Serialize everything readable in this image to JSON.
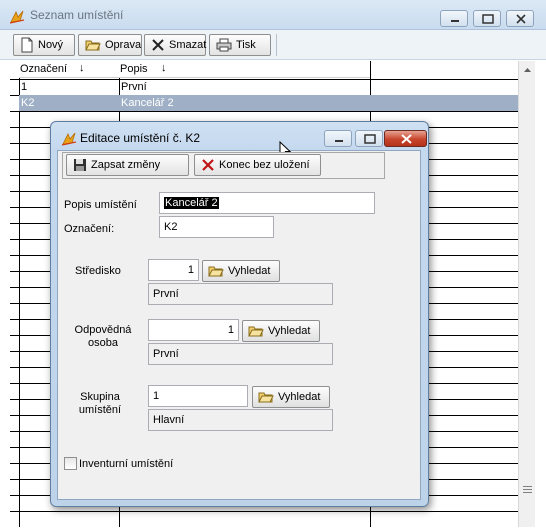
{
  "main_window": {
    "title": "Seznam umístění",
    "toolbar": {
      "new_label": "Nový",
      "edit_label": "Oprava",
      "delete_label": "Smazat",
      "print_label": "Tisk"
    },
    "grid": {
      "columns": [
        "Označení",
        "Popis"
      ],
      "sort_indicator": "↓",
      "rows": [
        {
          "code": "1",
          "description": "První",
          "selected": false
        },
        {
          "code": "K2",
          "description": "Kancelář 2",
          "selected": true
        }
      ]
    }
  },
  "dialog": {
    "title": "Editace umístění č. K2",
    "save_label": "Zapsat změny",
    "cancel_label": "Konec bez uložení",
    "fields": {
      "popis_label": "Popis umístění",
      "popis_value": "Kancelář 2",
      "oznaceni_label": "Označení:",
      "oznaceni_value": "K2",
      "stredisko_label": "Středisko",
      "stredisko_value": "1",
      "stredisko_name": "První",
      "odpovedna_label_1": "Odpovědná",
      "odpovedna_label_2": "osoba",
      "odpovedna_value": "1",
      "odpovedna_name": "První",
      "skupina_label_1": "Skupina",
      "skupina_label_2": "umístění",
      "skupina_value": "1",
      "skupina_name": "Hlavní",
      "lookup_label": "Vyhledat",
      "inventory_label": "Inventurní umístění",
      "inventory_checked": false
    }
  },
  "colors": {
    "selection_row": "#9fb0c6",
    "dialog_frame": "#c4d8ee",
    "close_button": "#c8452d"
  }
}
